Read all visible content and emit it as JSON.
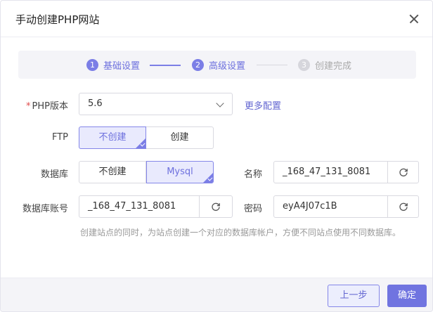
{
  "dialog": {
    "title": "手动创建PHP网站"
  },
  "steps": [
    {
      "num": "1",
      "label": "基础设置",
      "state": "active"
    },
    {
      "num": "2",
      "label": "高级设置",
      "state": "active"
    },
    {
      "num": "3",
      "label": "创建完成",
      "state": "todo"
    }
  ],
  "php": {
    "label": "PHP版本",
    "required_mark": "*",
    "value": "5.6",
    "more_link": "更多配置"
  },
  "ftp": {
    "label": "FTP",
    "options": [
      "不创建",
      "创建"
    ],
    "selected": "不创建"
  },
  "database": {
    "label": "数据库",
    "options": [
      "不创建",
      "Mysql"
    ],
    "selected": "Mysql"
  },
  "db_name": {
    "label": "名称",
    "value": "_168_47_131_8081"
  },
  "db_user": {
    "label": "数据库账号",
    "value": "_168_47_131_8081"
  },
  "db_password": {
    "label": "密码",
    "value": "eyA4J07c1B"
  },
  "hint": "创建站点的同时，为站点创建一个对应的数据库帐户，方便不同站点使用不同数据库。",
  "footer": {
    "prev_label": "上一步",
    "confirm_label": "确定"
  },
  "colors": {
    "accent": "#7074e0",
    "accent_light": "#e9eafd",
    "required": "#e04b4b"
  },
  "icons": {
    "close": "close-icon",
    "refresh": "refresh-icon",
    "dropdown": "chevron-down-icon",
    "selected": "check-corner-icon"
  }
}
